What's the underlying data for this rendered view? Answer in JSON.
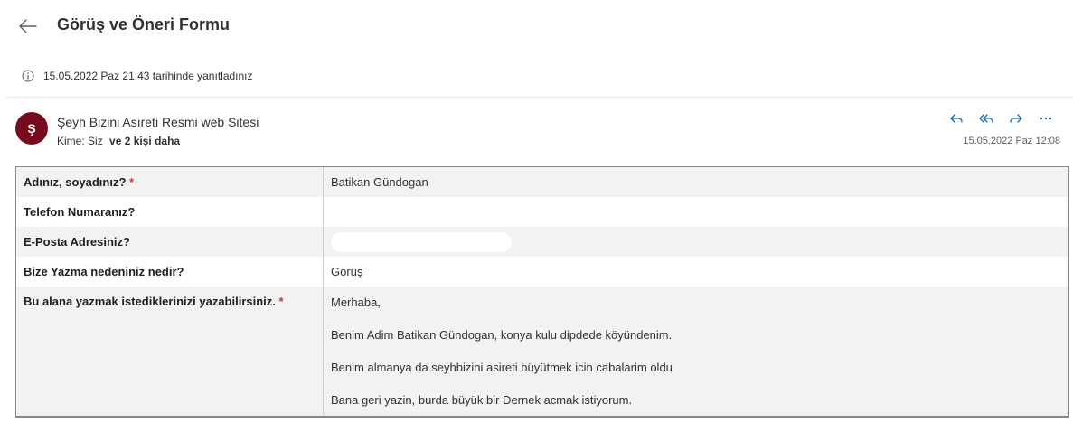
{
  "header": {
    "title": "Görüş ve Öneri Formu"
  },
  "notice": {
    "text": "15.05.2022 Paz 21:43 tarihinde yanıtladınız"
  },
  "email": {
    "avatar_letter": "Ş",
    "sender": "Şeyh Bizini Asıreti Resmi web Sitesi",
    "to_label": "Kime:",
    "to_me": "Siz",
    "to_others": "ve 2 kişi daha",
    "date": "15.05.2022 Paz 12:08",
    "colors": {
      "avatar": "#750b1c",
      "action_icon": "#0f6cbd",
      "required": "#d13438"
    }
  },
  "form": {
    "rows": [
      {
        "label": "Adınız, soyadınız?",
        "required": "*",
        "value": "Batikan Gündogan"
      },
      {
        "label": "Telefon Numaranız?",
        "value": ""
      },
      {
        "label": "E-Posta Adresiniz?",
        "value": ""
      },
      {
        "label": "Bize Yazma nedeniniz nedir?",
        "value": "Görüş"
      },
      {
        "label": "Bu alana yazmak istediklerinizi yazabilirsiniz.",
        "required": "*",
        "lines": [
          "Merhaba,",
          "Benim Adim Batikan Gündogan, konya kulu dipdede köyündenim.",
          "Benim almanya da seyhbizini asireti büyütmek icin cabalarim oldu",
          "Bana geri yazin, burda büyük bir Dernek acmak istiyorum."
        ]
      }
    ]
  }
}
